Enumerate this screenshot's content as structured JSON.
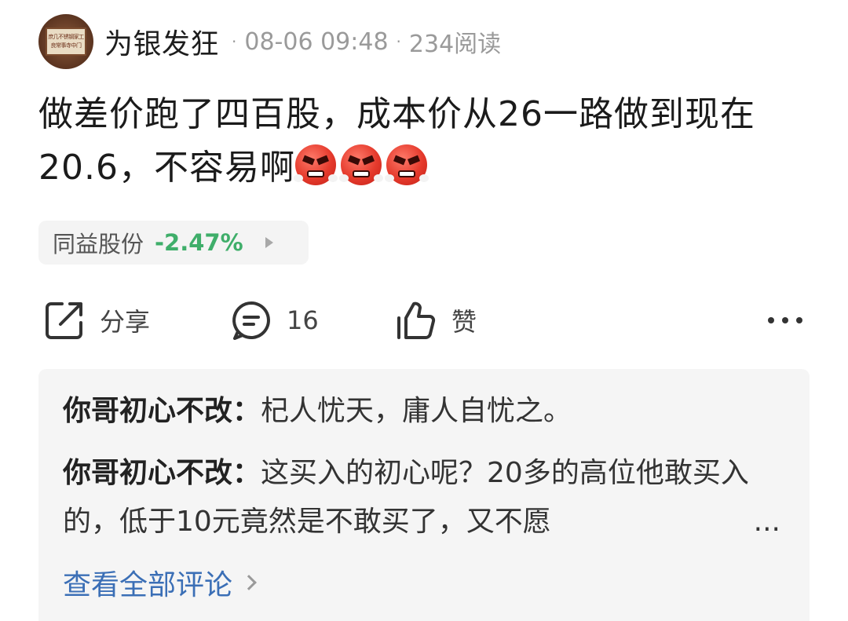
{
  "header": {
    "avatar_text": [
      "庶几不锈钢家工",
      "良常事寺中门"
    ],
    "username": "为银发狂",
    "separator": "·",
    "timestamp": "08-06 09:48",
    "reads": "234阅读"
  },
  "post": {
    "text": "做差价跑了四百股，成本价从26一路做到现在20.6，不容易啊",
    "emojis": [
      "angry-face-icon",
      "angry-face-icon",
      "angry-face-icon"
    ]
  },
  "stock": {
    "name": "同益股份",
    "change": "-2.47%",
    "change_color": "#3fae6a"
  },
  "actions": {
    "share_label": "分享",
    "comment_count": "16",
    "like_label": "赞",
    "more_icon": "more-horizontal-icon"
  },
  "comments": [
    {
      "author": "你哥初心不改",
      "sep": "：",
      "text": "杞人忧天，庸人自忧之。"
    },
    {
      "author": "你哥初心不改",
      "sep": "：",
      "text": "这买入的初心呢？20多的高位他敢买入的，低于10元竟然是不敢买了，又不愿",
      "ellipsis": "..."
    }
  ],
  "view_all_label": "查看全部评论",
  "colors": {
    "link": "#3b6fb6",
    "comments_bg": "#f5f5f5",
    "stock_bg": "#f4f4f4"
  }
}
